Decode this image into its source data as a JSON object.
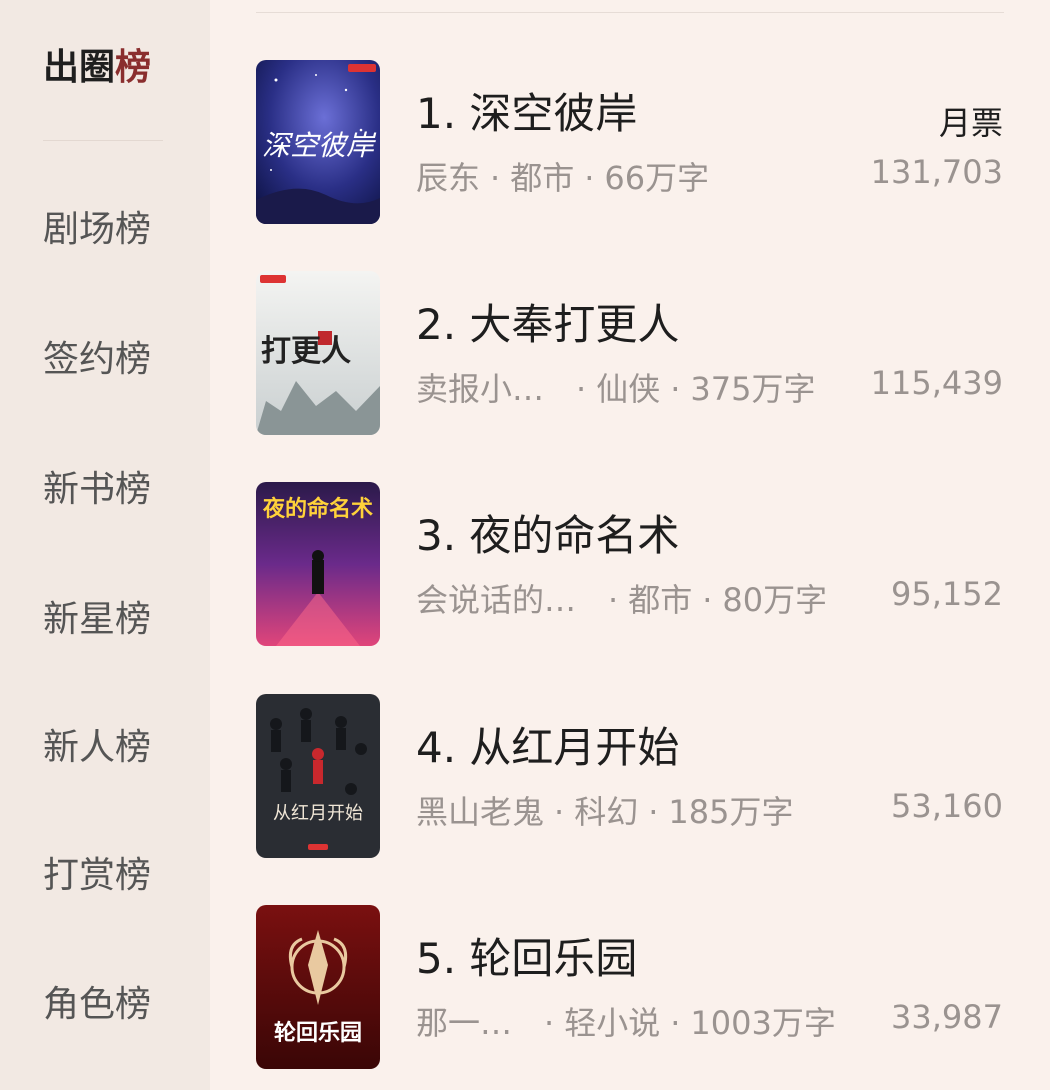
{
  "sidebar": {
    "items": [
      {
        "label_main": "出圈",
        "label_accent": "榜",
        "active": true
      },
      {
        "label": "剧场榜"
      },
      {
        "label": "签约榜"
      },
      {
        "label": "新书榜"
      },
      {
        "label": "新星榜"
      },
      {
        "label": "新人榜"
      },
      {
        "label": "打赏榜"
      },
      {
        "label": "角色榜"
      }
    ]
  },
  "column_header": {
    "votes_label": "月票"
  },
  "books": [
    {
      "rank_title": "1. 深空彼岸",
      "author": "辰东",
      "genre": "都市",
      "words": "66万字",
      "votes": "131,703",
      "cover_text": "深空彼岸"
    },
    {
      "rank_title": "2. 大奉打更人",
      "author": "卖报小…",
      "genre": "仙侠",
      "words": "375万字",
      "votes": "115,439",
      "cover_text": "打更人"
    },
    {
      "rank_title": "3. 夜的命名术",
      "author": "会说话的…",
      "genre": "都市",
      "words": "80万字",
      "votes": "95,152",
      "cover_text": "夜的命名术"
    },
    {
      "rank_title": "4. 从红月开始",
      "author": "黑山老鬼",
      "genre": "科幻",
      "words": "185万字",
      "votes": "53,160",
      "cover_text": "从红月开始"
    },
    {
      "rank_title": "5. 轮回乐园",
      "author": "那一…",
      "genre": "轻小说",
      "words": "1003万字",
      "votes": "33,987",
      "cover_text": "轮回乐园"
    }
  ]
}
